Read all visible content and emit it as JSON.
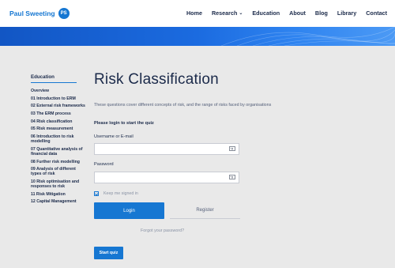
{
  "header": {
    "logo_text": "Paul Sweeting",
    "logo_mark": "PS",
    "nav": [
      {
        "label": "Home"
      },
      {
        "label": "Research",
        "has_dropdown": true
      },
      {
        "label": "Education"
      },
      {
        "label": "About"
      },
      {
        "label": "Blog"
      },
      {
        "label": "Library"
      },
      {
        "label": "Contact"
      }
    ]
  },
  "sidebar": {
    "title": "Education",
    "items": [
      {
        "label": "Overview"
      },
      {
        "label": "01 Introduction to ERM"
      },
      {
        "label": "02 External risk frameworks"
      },
      {
        "label": "03 The ERM process"
      },
      {
        "label": "04 Risk classification"
      },
      {
        "label": "05 Risk measurement"
      },
      {
        "label": "06 Introduction to risk modelling"
      },
      {
        "label": "07 Quantitative analysis of financial data"
      },
      {
        "label": "08 Further risk modelling"
      },
      {
        "label": "09 Analysis of different types of risk"
      },
      {
        "label": "10 Risk optimisation and responses to risk"
      },
      {
        "label": "11 Risk Mitigation"
      },
      {
        "label": "12 Capital Management"
      }
    ]
  },
  "main": {
    "title": "Risk Classification",
    "description": "These questions cover different concepts of risk, and the range of risks faced by organisations",
    "login_heading": "Please login to start the quiz",
    "username_label": "Username or E-mail",
    "password_label": "Password",
    "remember_label": "Keep me signed in",
    "login_button": "Login",
    "register_button": "Register",
    "forgot_link": "Forgot your password?",
    "start_button": "Start quiz"
  },
  "colors": {
    "accent": "#1677d2",
    "text": "#1b2a4a",
    "background": "#e9e9e9"
  }
}
